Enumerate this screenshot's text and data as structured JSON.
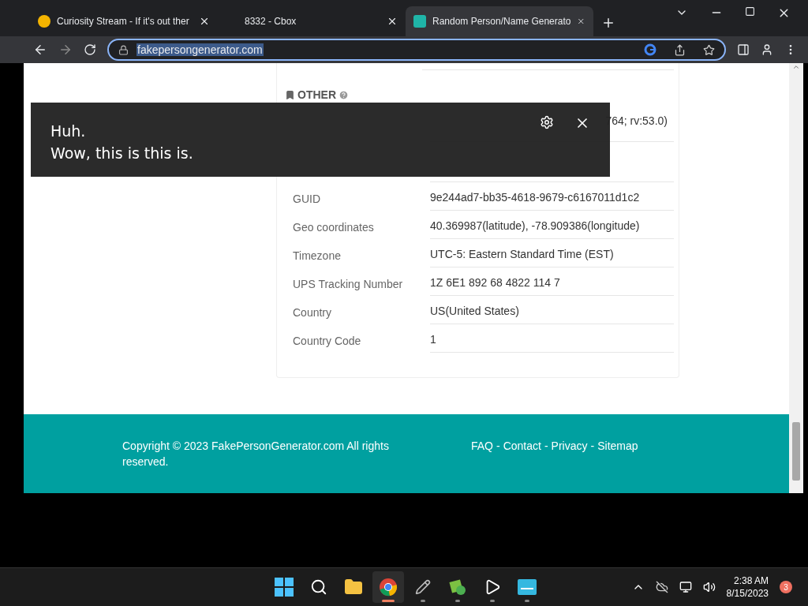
{
  "tabs": [
    {
      "title": "Curiosity Stream - If it's out ther",
      "selected": false
    },
    {
      "title": "8332 - Cbox",
      "selected": false
    },
    {
      "title": "Random Person/Name Generato",
      "selected": true
    }
  ],
  "address_bar": {
    "url": "fakepersongenerator.com"
  },
  "section": {
    "title": "OTHER"
  },
  "covered_rows": [
    {
      "value_fragment": "764; rv:53.0)"
    },
    {
      "value_fragment": ""
    }
  ],
  "rows": [
    {
      "label": "GUID",
      "value": "9e244ad7-bb35-4618-9679-c6167011d1c2"
    },
    {
      "label": "Geo coordinates",
      "value": "40.369987(latitude), -78.909386(longitude)"
    },
    {
      "label": "Timezone",
      "value": "UTC-5: Eastern Standard Time (EST)"
    },
    {
      "label": "UPS Tracking Number",
      "value": "1Z 6E1 892 68 4822 114 7"
    },
    {
      "label": "Country",
      "value": "US(United States)"
    },
    {
      "label": "Country Code",
      "value": "1"
    }
  ],
  "caption": {
    "lines": [
      "Huh.",
      "Wow, this is this is."
    ]
  },
  "footer": {
    "copyright": "Copyright © 2023 FakePersonGenerator.com All rights reserved.",
    "links": [
      "FAQ",
      "Contact",
      "Privacy",
      "Sitemap"
    ],
    "separator": "-"
  },
  "taskbar": {
    "time": "2:38 AM",
    "date": "8/15/2023",
    "notifications": "3",
    "apps": [
      {
        "kind": "start",
        "selected": false
      },
      {
        "kind": "search",
        "selected": false
      },
      {
        "kind": "folder",
        "selected": false
      },
      {
        "kind": "browser",
        "selected": true
      },
      {
        "kind": "tool",
        "selected": false
      },
      {
        "kind": "paint",
        "selected": false
      },
      {
        "kind": "player",
        "selected": false
      },
      {
        "kind": "monitor",
        "selected": false
      }
    ]
  }
}
